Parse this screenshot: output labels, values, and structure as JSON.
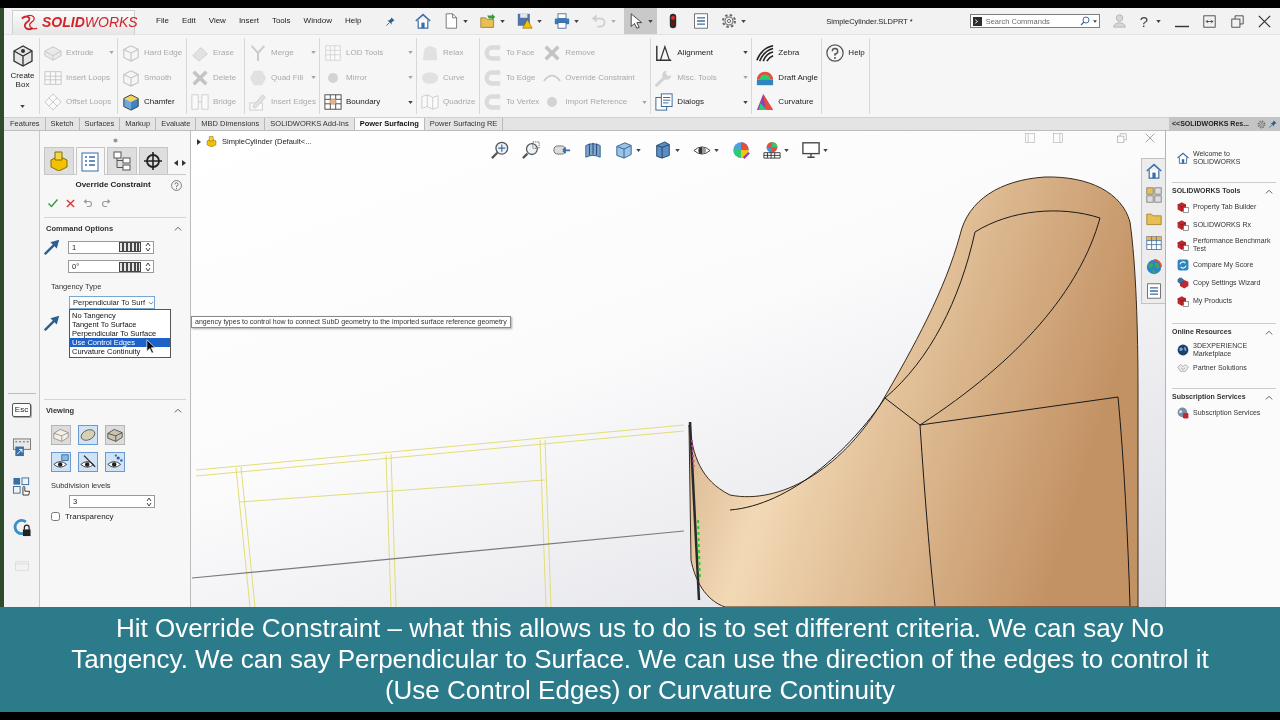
{
  "menubar": {
    "brand": "**SOLID**WORKS",
    "menus": [
      "File",
      "Edit",
      "View",
      "Insert",
      "Tools",
      "Window",
      "Help"
    ],
    "quick_access": [
      {
        "active": false,
        "disabled": false,
        "dropdown": false
      },
      {
        "active": false,
        "disabled": false,
        "dropdown": true
      },
      {
        "active": false,
        "disabled": false,
        "dropdown": true
      },
      {
        "active": false,
        "disabled": false,
        "dropdown": true
      },
      {
        "active": false,
        "disabled": false,
        "dropdown": true
      },
      {
        "active": false,
        "disabled": true,
        "dropdown": true
      },
      {
        "active": true,
        "disabled": false,
        "dropdown": true
      },
      {
        "active": false,
        "disabled": false,
        "dropdown": false
      },
      {
        "active": false,
        "disabled": false,
        "dropdown": false
      },
      {
        "active": false,
        "disabled": false,
        "dropdown": true
      }
    ],
    "document_title": "SimpleCylinder.SLDPRT *",
    "search": {
      "placeholder": "Search Commands"
    },
    "help": "?"
  },
  "ribbon": {
    "create_box": "Create Box",
    "sections": [
      {
        "columns": [
          [
            {
              "label": "Extrude",
              "disabled": true,
              "dropdown": true
            },
            {
              "label": "Insert Loops",
              "disabled": true,
              "dropdown": false
            },
            {
              "label": "Offset Loops",
              "disabled": true,
              "dropdown": false
            }
          ]
        ]
      },
      {
        "columns": [
          [
            {
              "label": "Hard Edge",
              "disabled": true,
              "dropdown": false
            },
            {
              "label": "Smooth",
              "disabled": true,
              "dropdown": false
            },
            {
              "label": "Chamfer",
              "disabled": false,
              "dropdown": false
            }
          ]
        ]
      },
      {
        "columns": [
          [
            {
              "label": "Erase",
              "disabled": true,
              "dropdown": false
            },
            {
              "label": "Delete",
              "disabled": true,
              "dropdown": false
            },
            {
              "label": "Bridge",
              "disabled": true,
              "dropdown": false
            }
          ]
        ]
      },
      {
        "columns": [
          [
            {
              "label": "Merge",
              "disabled": true,
              "dropdown": true
            },
            {
              "label": "Quad Fill",
              "disabled": true,
              "dropdown": true
            },
            {
              "label": "Insert Edges",
              "disabled": true,
              "dropdown": false
            }
          ]
        ]
      },
      {
        "columns": [
          [
            {
              "label": "LOD Tools",
              "disabled": true,
              "dropdown": true
            },
            {
              "label": "Mirror",
              "disabled": true,
              "dropdown": true
            },
            {
              "label": "Boundary",
              "disabled": false,
              "dropdown": true
            }
          ]
        ]
      },
      {
        "columns": [
          [
            {
              "label": "Relax",
              "disabled": true,
              "dropdown": false
            },
            {
              "label": "Curve",
              "disabled": true,
              "dropdown": false
            },
            {
              "label": "Quadrize",
              "disabled": true,
              "dropdown": false
            }
          ]
        ]
      },
      {
        "columns": [
          [
            {
              "label": "To Face",
              "disabled": true,
              "dropdown": false
            },
            {
              "label": "To Edge",
              "disabled": true,
              "dropdown": false
            },
            {
              "label": "To Vertex",
              "disabled": true,
              "dropdown": false
            }
          ],
          [
            {
              "label": "Remove",
              "disabled": true,
              "dropdown": false
            },
            {
              "label": "Override Constraint",
              "disabled": true,
              "dropdown": false
            },
            {
              "label": "Import Reference",
              "disabled": true,
              "dropdown": true
            }
          ]
        ]
      },
      {
        "columns": [
          [
            {
              "label": "Alignment",
              "disabled": false,
              "dropdown": true
            },
            {
              "label": "Misc. Tools",
              "disabled": true,
              "dropdown": true
            },
            {
              "label": "Dialogs",
              "disabled": false,
              "dropdown": true
            }
          ]
        ]
      },
      {
        "columns": [
          [
            {
              "label": "Zebra",
              "disabled": false,
              "dropdown": false
            },
            {
              "label": "Draft Angle",
              "disabled": false,
              "dropdown": false
            },
            {
              "label": "Curvature",
              "disabled": false,
              "dropdown": false
            }
          ]
        ]
      },
      {
        "columns": [
          [
            {
              "label": "Help",
              "disabled": false,
              "dropdown": false
            }
          ]
        ]
      }
    ]
  },
  "command_tabs": [
    {
      "label": "Features",
      "selected": false
    },
    {
      "label": "Sketch",
      "selected": false
    },
    {
      "label": "Surfaces",
      "selected": false
    },
    {
      "label": "Markup",
      "selected": false
    },
    {
      "label": "Evaluate",
      "selected": false
    },
    {
      "label": "MBD Dimensions",
      "selected": false
    },
    {
      "label": "SOLIDWORKS Add-Ins",
      "selected": false
    },
    {
      "label": "Power Surfacing",
      "selected": true
    },
    {
      "label": "Power Surfacing RE",
      "selected": false
    }
  ],
  "side_strip": {
    "esc_key": "Esc"
  },
  "property_manager": {
    "tabs": [
      {
        "selected": false
      },
      {
        "selected": true
      },
      {
        "selected": false
      },
      {
        "selected": false
      }
    ],
    "title": "Override Constraint",
    "command_options": {
      "heading": "Command Options",
      "expanded": true,
      "fields": [
        {
          "value": "1"
        },
        {
          "value": "0°"
        }
      ],
      "tangency_label": "Tangency Type",
      "tangency_value": "Perpendicular To Surf",
      "tangency_options": [
        {
          "label": "No Tangency",
          "selected": false
        },
        {
          "label": "Tangent To Surface",
          "selected": false
        },
        {
          "label": "Perpendicular To Surface",
          "selected": false
        },
        {
          "label": "Use Control Edges",
          "selected": true
        },
        {
          "label": "Curvature Continuity",
          "selected": false
        }
      ]
    },
    "viewing": {
      "heading": "Viewing",
      "expanded": true,
      "display_buttons": [
        {
          "active": false
        },
        {
          "active": true
        },
        {
          "active": false
        },
        {
          "active": true
        },
        {
          "active": true
        },
        {
          "active": true
        }
      ],
      "subdivision_label": "Subdivision levels",
      "subdivision_value": "3",
      "transparency": {
        "label": "Transparency",
        "checked": false
      }
    }
  },
  "viewport": {
    "tree_item": "SimpleCylinder (Default<...",
    "tooltip": "angency types to control how to connect SubD geometry to the imported surface reference geometry"
  },
  "task_pane": {
    "title": "<<SOLIDWORKS Res...",
    "welcome": "Welcome to SOLIDWORKS",
    "sections": [
      {
        "heading": "SOLIDWORKS Tools",
        "expanded": true,
        "items": [
          "Property Tab Builder",
          "SOLIDWORKS Rx",
          "Performance Benchmark Test",
          "Compare My Score",
          "Copy Settings Wizard",
          "My Products"
        ]
      },
      {
        "heading": "Online Resources",
        "expanded": true,
        "items": [
          "3DEXPERIENCE Marketplace",
          "Partner Solutions"
        ]
      },
      {
        "heading": "Subscription Services",
        "expanded": true,
        "items": [
          "Subscription Services"
        ]
      }
    ]
  },
  "caption": "Hit Override Constraint – what this allows us to do is to set different criteria. We can say No Tangency. We can say Perpendicular to Surface. We can use the direction of the edges to control it (Use Control Edges) or Curvature Continuity"
}
